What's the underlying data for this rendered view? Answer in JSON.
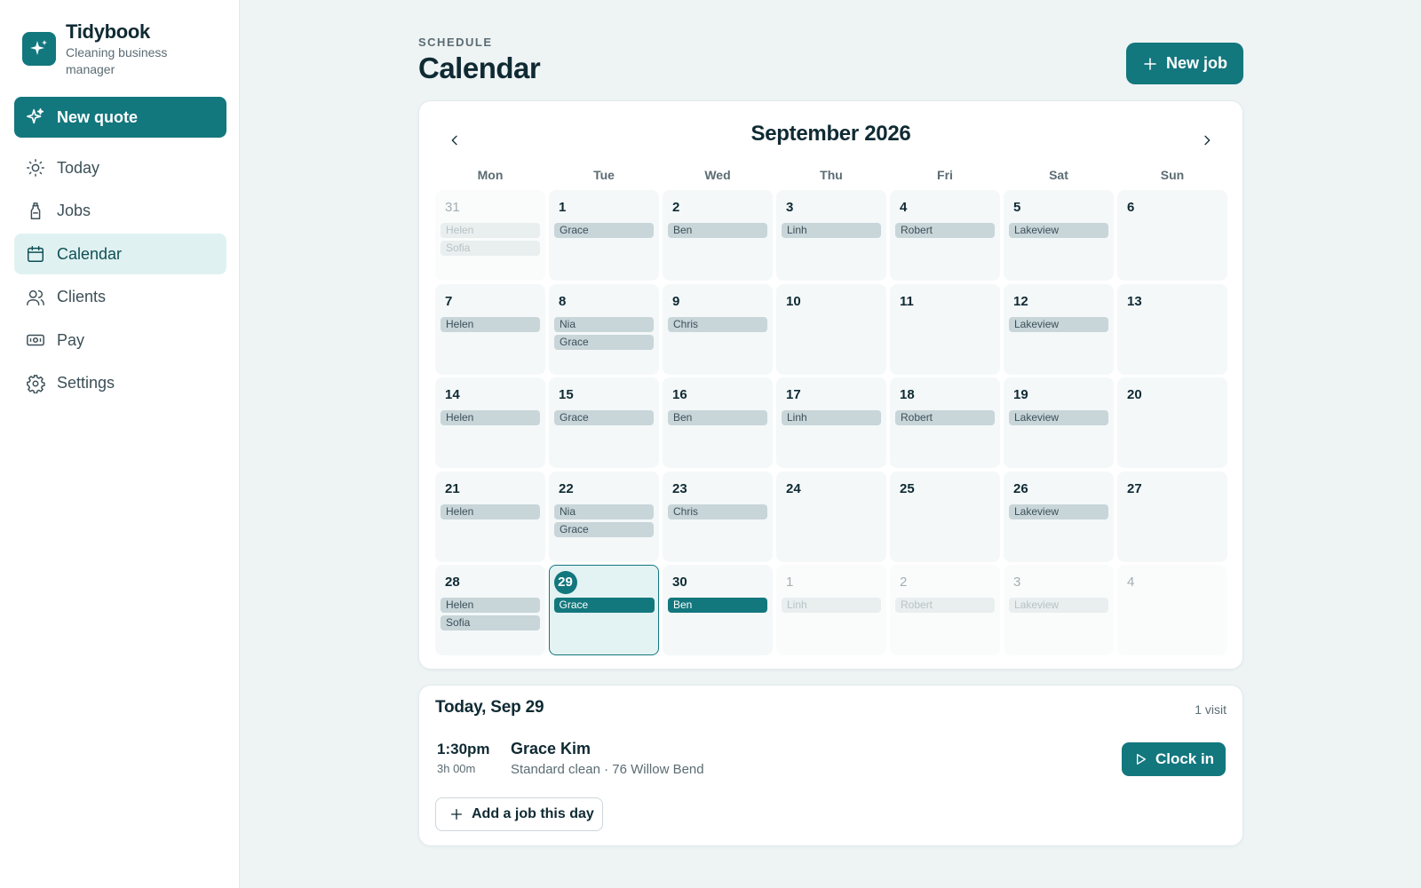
{
  "app": {
    "name": "Tidybook",
    "tagline": "Cleaning business manager"
  },
  "sidebar": {
    "new_quote_label": "New quote",
    "items": [
      {
        "label": "Today",
        "icon": "sun-icon",
        "active": false
      },
      {
        "label": "Jobs",
        "icon": "spray-bottle-icon",
        "active": false
      },
      {
        "label": "Calendar",
        "icon": "calendar-icon",
        "active": true
      },
      {
        "label": "Clients",
        "icon": "users-icon",
        "active": false
      },
      {
        "label": "Pay",
        "icon": "banknote-icon",
        "active": false
      },
      {
        "label": "Settings",
        "icon": "gear-icon",
        "active": false
      }
    ]
  },
  "header": {
    "eyebrow": "SCHEDULE",
    "title": "Calendar",
    "new_job_label": "New job"
  },
  "calendar": {
    "month_label": "September 2026",
    "weekdays": [
      "Mon",
      "Tue",
      "Wed",
      "Thu",
      "Fri",
      "Sat",
      "Sun"
    ],
    "days": [
      {
        "num": "31",
        "muted": true,
        "events": [
          {
            "label": "Helen"
          },
          {
            "label": "Sofia"
          }
        ]
      },
      {
        "num": "1",
        "events": [
          {
            "label": "Grace"
          }
        ]
      },
      {
        "num": "2",
        "events": [
          {
            "label": "Ben"
          }
        ]
      },
      {
        "num": "3",
        "events": [
          {
            "label": "Linh"
          }
        ]
      },
      {
        "num": "4",
        "events": [
          {
            "label": "Robert"
          }
        ]
      },
      {
        "num": "5",
        "events": [
          {
            "label": "Lakeview"
          }
        ]
      },
      {
        "num": "6",
        "events": []
      },
      {
        "num": "7",
        "events": [
          {
            "label": "Helen"
          }
        ]
      },
      {
        "num": "8",
        "events": [
          {
            "label": "Nia"
          },
          {
            "label": "Grace"
          }
        ]
      },
      {
        "num": "9",
        "events": [
          {
            "label": "Chris"
          }
        ]
      },
      {
        "num": "10",
        "events": []
      },
      {
        "num": "11",
        "events": []
      },
      {
        "num": "12",
        "events": [
          {
            "label": "Lakeview"
          }
        ]
      },
      {
        "num": "13",
        "events": []
      },
      {
        "num": "14",
        "events": [
          {
            "label": "Helen"
          }
        ]
      },
      {
        "num": "15",
        "events": [
          {
            "label": "Grace"
          }
        ]
      },
      {
        "num": "16",
        "events": [
          {
            "label": "Ben"
          }
        ]
      },
      {
        "num": "17",
        "events": [
          {
            "label": "Linh"
          }
        ]
      },
      {
        "num": "18",
        "events": [
          {
            "label": "Robert"
          }
        ]
      },
      {
        "num": "19",
        "events": [
          {
            "label": "Lakeview"
          }
        ]
      },
      {
        "num": "20",
        "events": []
      },
      {
        "num": "21",
        "events": [
          {
            "label": "Helen"
          }
        ]
      },
      {
        "num": "22",
        "events": [
          {
            "label": "Nia"
          },
          {
            "label": "Grace"
          }
        ]
      },
      {
        "num": "23",
        "events": [
          {
            "label": "Chris"
          }
        ]
      },
      {
        "num": "24",
        "events": []
      },
      {
        "num": "25",
        "events": []
      },
      {
        "num": "26",
        "events": [
          {
            "label": "Lakeview"
          }
        ]
      },
      {
        "num": "27",
        "events": []
      },
      {
        "num": "28",
        "events": [
          {
            "label": "Helen"
          },
          {
            "label": "Sofia"
          }
        ]
      },
      {
        "num": "29",
        "today": true,
        "events": [
          {
            "label": "Grace",
            "style": "dark"
          }
        ]
      },
      {
        "num": "30",
        "events": [
          {
            "label": "Ben",
            "style": "dark"
          }
        ]
      },
      {
        "num": "1",
        "muted": true,
        "events": [
          {
            "label": "Linh",
            "style": "light"
          }
        ]
      },
      {
        "num": "2",
        "muted": true,
        "events": [
          {
            "label": "Robert",
            "style": "light"
          }
        ]
      },
      {
        "num": "3",
        "muted": true,
        "events": [
          {
            "label": "Lakeview",
            "style": "light"
          }
        ]
      },
      {
        "num": "4",
        "muted": true,
        "events": []
      }
    ]
  },
  "today": {
    "title": "Today, Sep 29",
    "visit_count": "1 visit",
    "visit": {
      "time": "1:30pm",
      "duration": "3h 00m",
      "client": "Grace Kim",
      "detail": "Standard clean · 76 Willow Bend"
    },
    "clock_in_label": "Clock in",
    "add_job_label": "Add a job this day"
  },
  "colors": {
    "accent": "#13777e",
    "accent_light": "#e0f1f1",
    "background": "#eef3f4"
  }
}
